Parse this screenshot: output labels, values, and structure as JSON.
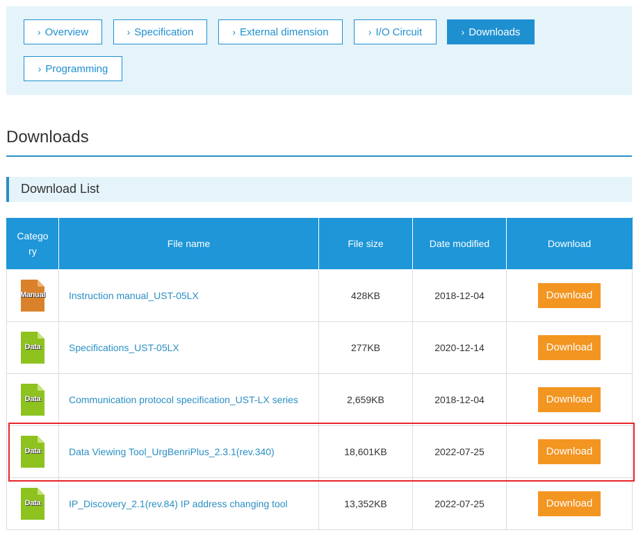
{
  "tabs": [
    {
      "label": "Overview",
      "active": false
    },
    {
      "label": "Specification",
      "active": false
    },
    {
      "label": "External dimension",
      "active": false
    },
    {
      "label": "I/O Circuit",
      "active": false
    },
    {
      "label": "Downloads",
      "active": true
    },
    {
      "label": "Programming",
      "active": false
    }
  ],
  "section_title": "Downloads",
  "subsection_title": "Download List",
  "table": {
    "headers": {
      "category": "Catego ry",
      "file_name": "File name",
      "file_size": "File size",
      "date_modified": "Date modified",
      "download": "Download"
    },
    "rows": [
      {
        "category": "Manual",
        "icon": "manual-icon",
        "file_name": "Instruction manual_UST-05LX",
        "file_size": "428KB",
        "date": "2018-12-04",
        "button": "Download"
      },
      {
        "category": "Data",
        "icon": "data-icon",
        "file_name": "Specifications_UST-05LX",
        "file_size": "277KB",
        "date": "2020-12-14",
        "button": "Download"
      },
      {
        "category": "Data",
        "icon": "data-icon",
        "file_name": "Communication protocol specification_UST-LX series",
        "file_size": "2,659KB",
        "date": "2018-12-04",
        "button": "Download"
      },
      {
        "category": "Data",
        "icon": "data-icon",
        "file_name": "Data Viewing Tool_UrgBenriPlus_2.3.1(rev.340)",
        "file_size": "18,601KB",
        "date": "2022-07-25",
        "button": "Download"
      },
      {
        "category": "Data",
        "icon": "data-icon",
        "file_name": "IP_Discovery_2.1(rev.84) IP address changing tool",
        "file_size": "13,352KB",
        "date": "2022-07-25",
        "button": "Download"
      }
    ]
  },
  "colors": {
    "accent": "#1e96d8",
    "panel": "#e5f3fa",
    "download_button": "#f39521",
    "manual_icon": "#d9822b",
    "data_icon": "#8dc21f",
    "highlight": "#e8242a"
  }
}
